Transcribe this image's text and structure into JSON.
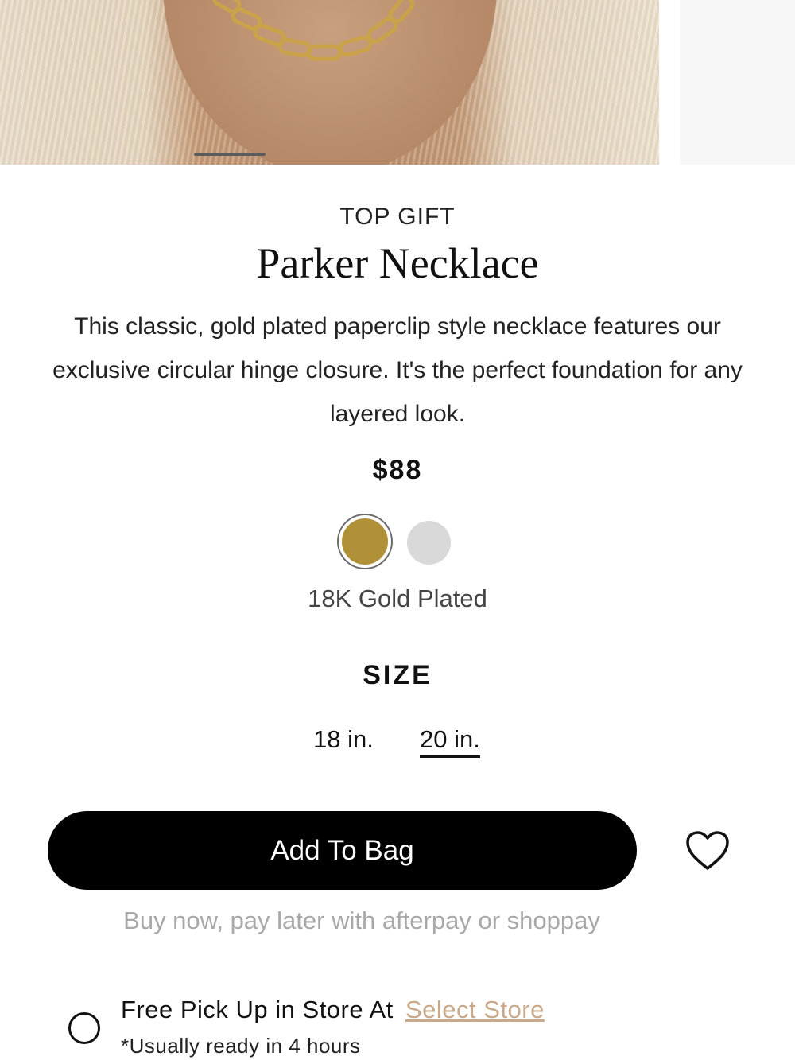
{
  "product": {
    "eyebrow": "TOP GIFT",
    "name": "Parker Necklace",
    "description": "This classic, gold plated paperclip style necklace features our exclusive circular hinge closure. It's the perfect foundation for any layered look.",
    "price": "$88"
  },
  "finish": {
    "selected_label": "18K Gold Plated",
    "swatches": [
      {
        "name": "gold",
        "color": "#b09137",
        "selected": true
      },
      {
        "name": "silver",
        "color": "#d9d9d9",
        "selected": false
      }
    ]
  },
  "size": {
    "heading": "SIZE",
    "options": [
      {
        "label": "18 in.",
        "selected": false
      },
      {
        "label": "20 in.",
        "selected": true
      }
    ]
  },
  "actions": {
    "add_to_bag": "Add To Bag",
    "wishlist_icon": "heart-icon"
  },
  "payment_note": "Buy now, pay later with afterpay or shoppay",
  "pickup": {
    "label": "Free Pick Up in Store At",
    "link": "Select Store",
    "note": "*Usually ready in 4 hours"
  },
  "colors": {
    "primary": "#000000",
    "accent_link": "#c9a98a",
    "muted_text": "#a8a8a8"
  }
}
